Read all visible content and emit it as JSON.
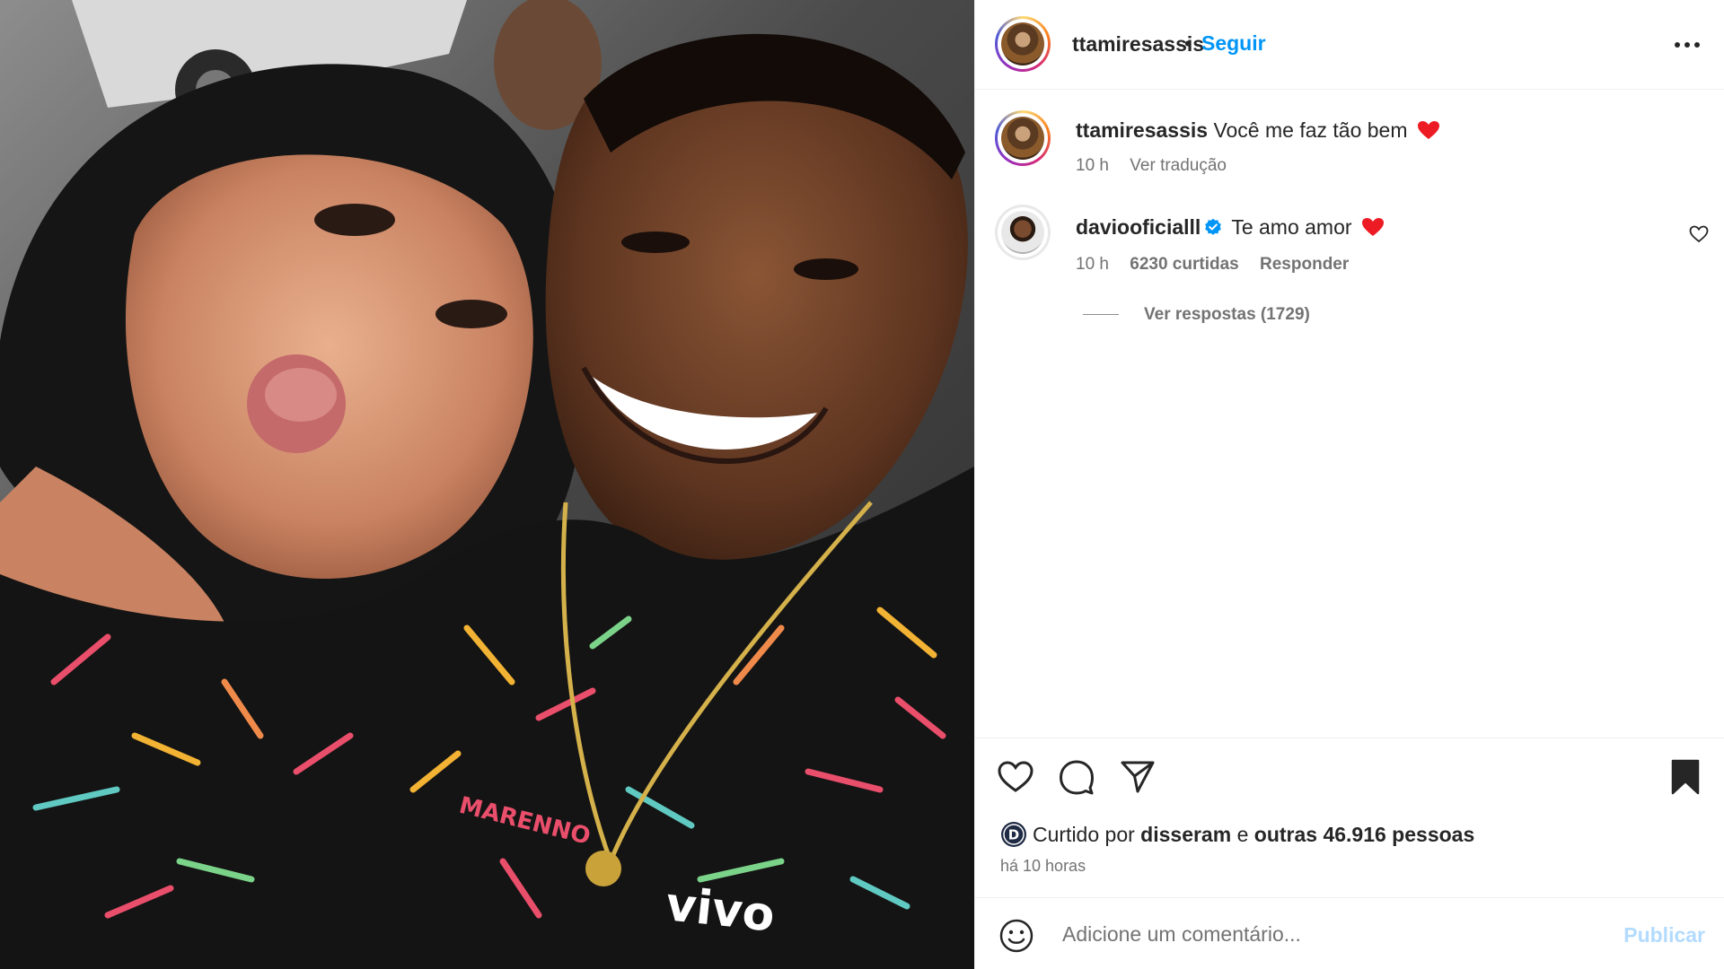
{
  "post": {
    "author": "ttamiresassis",
    "bullet": "•",
    "follow_label": "Seguir",
    "more_icon": "more-horizontal-icon"
  },
  "caption": {
    "username": "ttamiresassis",
    "text": "Você me faz tão bem",
    "emoji": "❤️",
    "time": "10 h",
    "translate_label": "Ver tradução"
  },
  "top_comment": {
    "username": "daviooficialll",
    "verified": true,
    "text": "Te amo amor",
    "emoji": "❤️",
    "time": "10 h",
    "likes_label": "6230 curtidas",
    "reply_label": "Responder",
    "view_replies_label": "Ver respostas (1729)"
  },
  "actions": {
    "like_icon": "heart-icon",
    "comment_icon": "comment-icon",
    "share_icon": "send-icon",
    "save_icon": "bookmark-filled-icon"
  },
  "likes": {
    "prefix": "Curtido por",
    "user": "disseram",
    "connector": "e",
    "others": "outras 46.916 pessoas",
    "posted_ago": "há 10 horas"
  },
  "composer": {
    "placeholder": "Adicione um comentário...",
    "publish_label": "Publicar"
  },
  "photo": {
    "shirt_text_1": "vivo",
    "shirt_text_2": "MARENNO"
  },
  "colors": {
    "accent": "#0095f6",
    "publish_disabled": "#b3dbff",
    "heart_red": "#ed1c24",
    "verified_blue": "#0095f6",
    "muted": "#737373"
  }
}
